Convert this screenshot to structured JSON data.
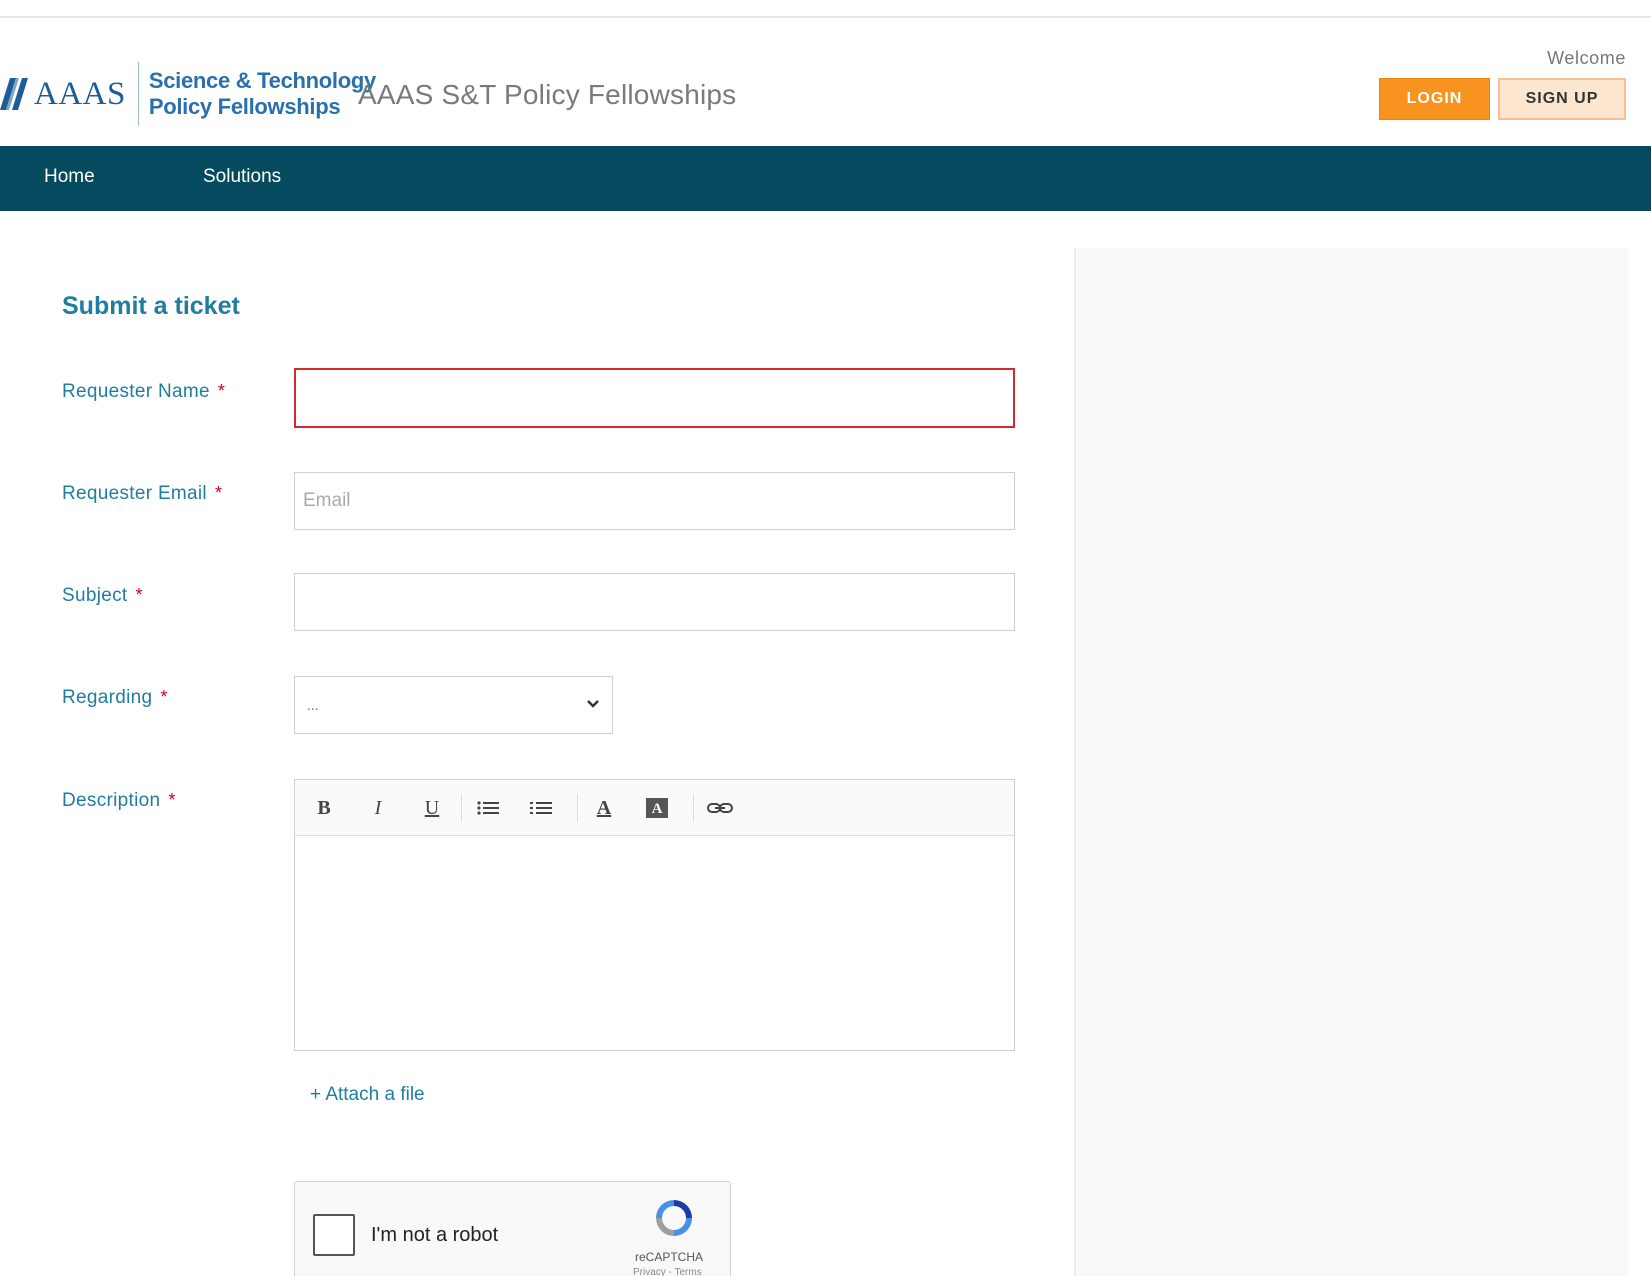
{
  "header": {
    "logo_text": "AAAS",
    "logo_sub_line1": "Science & Technology",
    "logo_sub_line2": "Policy Fellowships",
    "site_title": "AAAS S&T Policy Fellowships",
    "welcome": "Welcome",
    "login_label": "LOGIN",
    "signup_label": "SIGN UP"
  },
  "nav": {
    "items": [
      {
        "label": "Home"
      },
      {
        "label": "Solutions"
      }
    ]
  },
  "form": {
    "title": "Submit a ticket",
    "required_marker": "*",
    "name_label": "Requester Name",
    "name_value": "",
    "email_label": "Requester Email",
    "email_placeholder": "Email",
    "subject_label": "Subject",
    "subject_value": "",
    "regarding_label": "Regarding",
    "regarding_value": "...",
    "description_label": "Description",
    "attach_label": "+ Attach a file"
  },
  "toolbar": {
    "bold": "B",
    "italic": "I",
    "underline": "U",
    "font_color": "A"
  },
  "captcha": {
    "label": "I'm not a robot",
    "brand": "reCAPTCHA",
    "terms": "Privacy - Terms"
  },
  "colors": {
    "nav_bg": "#054a5f",
    "accent": "#1f7ea0",
    "login_bg": "#f7931e",
    "error_border": "#d0292e"
  },
  "icons": {
    "logo": "aaas-logo-icon",
    "chevron": "chevron-down-icon",
    "bullet_list": "bullet-list-icon",
    "numbered_list": "numbered-list-icon",
    "bg_color": "background-color-icon",
    "link": "link-icon",
    "recaptcha": "recaptcha-icon"
  }
}
